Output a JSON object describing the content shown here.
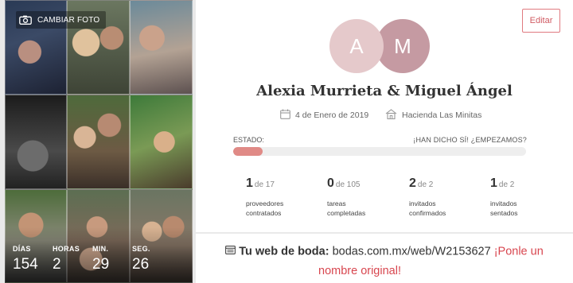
{
  "cover": {
    "change_photo_label": "CAMBIAR FOTO",
    "photos": [
      "couple-photo",
      "couple-photo",
      "couple-photo",
      "couple-photo",
      "couple-photo",
      "couple-photo",
      "couple-photo",
      "couple-photo",
      "couple-photo"
    ]
  },
  "countdown": [
    {
      "label": "DÍAS",
      "value": "154"
    },
    {
      "label": "HORAS",
      "value": "2"
    },
    {
      "label": "MIN.",
      "value": "29"
    },
    {
      "label": "SEG.",
      "value": "26"
    }
  ],
  "profile": {
    "edit_label": "Editar",
    "initial_a": "A",
    "initial_m": "M",
    "couple_name": "Alexia Murrieta & Miguel Ángel",
    "date": "4 de Enero de 2019",
    "venue": "Hacienda Las Minitas",
    "status_label": "ESTADO:",
    "status_cta": "¡HAN DICHO SÍ! ¿EMPEZAMOS?",
    "progress": 0.1
  },
  "stats": [
    {
      "count": "1",
      "total": "de 17",
      "desc": "proveedores\ncontratados"
    },
    {
      "count": "0",
      "total": "de 105",
      "desc": "tareas\ncompletadas"
    },
    {
      "count": "2",
      "total": "de 2",
      "desc": "invitados\nconfirmados"
    },
    {
      "count": "1",
      "total": "de 2",
      "desc": "invitados\nsentados"
    }
  ],
  "wedding_web": {
    "label": "Tu web de boda:",
    "url": "bodas.com.mx/web/W2153627",
    "cta_line1": "¡Ponle un",
    "cta_line2": "nombre original!"
  },
  "colors": {
    "accent": "#d8464f",
    "progress": "#e08a86",
    "avatar_a": "#e5c9cb",
    "avatar_m": "#c59aa2"
  }
}
